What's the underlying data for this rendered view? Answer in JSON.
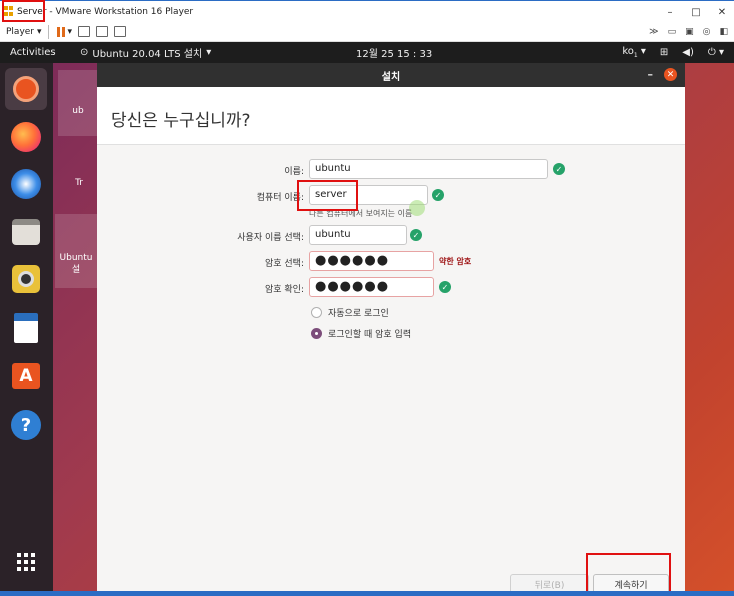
{
  "vmware": {
    "vm_name": "Server",
    "title_rest": " - VMware Workstation 16 Player",
    "minimize": "–",
    "maximize": "□",
    "close": "✕",
    "player_menu": "Player",
    "dropdown_glyph": "▾"
  },
  "ubuntu_topbar": {
    "activities": "Activities",
    "app_menu": "Ubuntu 20.04 LTS 설치",
    "clock": "12월 25  15 : 33",
    "input_method": "ko",
    "input_method_sub": "1"
  },
  "desktop_icons": {
    "icon1_label": "ub",
    "icon2_label": "Tr",
    "icon3_label": "Ubuntu",
    "icon3_sub": "설"
  },
  "installer": {
    "window_title": "설치",
    "minimize": "–",
    "close": "✕",
    "heading": "당신은 누구십니까?",
    "name_label": "이름:",
    "name_value": "ubuntu",
    "computer_label": "컴퓨터 이름:",
    "computer_value": "server",
    "computer_hint": "다른 컴퓨터에서 보여지는 이름",
    "username_label": "사용자 이름 선택:",
    "username_value": "ubuntu",
    "password_label": "암호 선택:",
    "password_value": "●●●●●●",
    "password_strength": "약한 암호",
    "confirm_label": "암호 확인:",
    "confirm_value": "●●●●●●",
    "auto_login": "자동으로 로그인",
    "require_password": "로그인할 때 암호 입력",
    "back_button": "뒤로(B)",
    "continue_button": "계속하기"
  },
  "colors": {
    "ubuntu_orange": "#e95420",
    "check_green": "#26a269",
    "annotation_red": "#e01010",
    "weak_password": "#a0191a"
  }
}
